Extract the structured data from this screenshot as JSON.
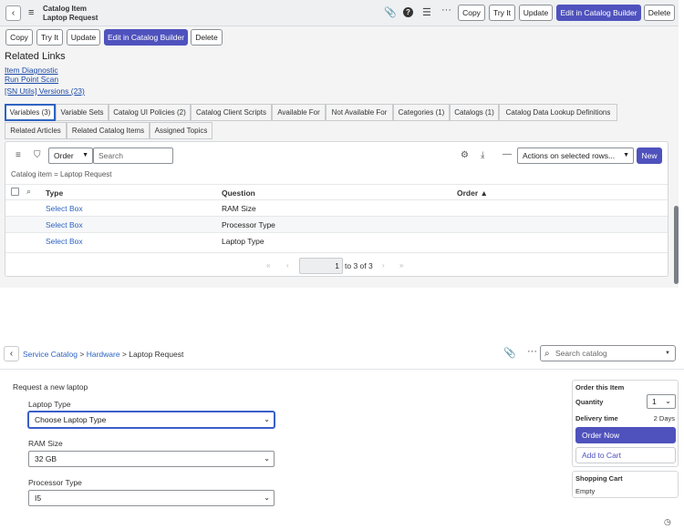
{
  "form": {
    "record_type": "Catalog Item",
    "record_name": "Laptop Request",
    "buttons": {
      "copy": "Copy",
      "try_it": "Try It",
      "update": "Update",
      "edit_builder": "Edit in Catalog Builder",
      "delete": "Delete"
    }
  },
  "related_links": {
    "title": "Related Links",
    "items": [
      "Item Diagnostic",
      "Run Point Scan",
      "[SN Utils] Versions (23)"
    ]
  },
  "tabs": [
    "Variables (3)",
    "Variable Sets",
    "Catalog UI Policies (2)",
    "Catalog Client Scripts",
    "Available For",
    "Not Available For",
    "Categories (1)",
    "Catalogs (1)",
    "Catalog Data Lookup Definitions",
    "Related Articles",
    "Related Catalog Items",
    "Assigned Topics"
  ],
  "list": {
    "field_select": "Order",
    "search_placeholder": "Search",
    "actions_select": "Actions on selected rows...",
    "new_button": "New",
    "condition": "Catalog item = Laptop Request",
    "columns": {
      "type": "Type",
      "question": "Question",
      "order": "Order"
    },
    "rows": [
      {
        "type": "Select Box",
        "question": "RAM Size"
      },
      {
        "type": "Select Box",
        "question": "Processor Type"
      },
      {
        "type": "Select Box",
        "question": "Laptop Type"
      }
    ],
    "page_input": "1",
    "page_range": "to 3 of 3"
  },
  "portal": {
    "breadcrumb": {
      "root": "Service Catalog",
      "category": "Hardware",
      "sep": ">",
      "current": "> Laptop Request"
    },
    "search_placeholder": "Search catalog",
    "form_title": "Request a new laptop",
    "fields": [
      {
        "label": "Laptop Type",
        "value": "Choose Laptop Type"
      },
      {
        "label": "RAM Size",
        "value": "32 GB"
      },
      {
        "label": "Processor Type",
        "value": "I5"
      }
    ],
    "order": {
      "title": "Order this Item",
      "quantity_label": "Quantity",
      "quantity_value": "1",
      "delivery_label": "Delivery time",
      "delivery_value": "2 Days",
      "order_now": "Order Now",
      "add_to_cart": "Add to Cart"
    },
    "cart": {
      "title": "Shopping Cart",
      "status": "Empty"
    }
  }
}
